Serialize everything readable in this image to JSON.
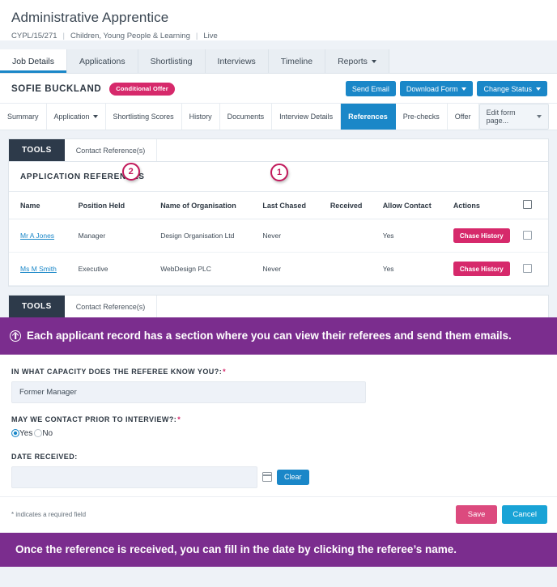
{
  "job": {
    "title": "Administrative Apprentice",
    "reference": "CYPL/15/271",
    "department": "Children, Young People & Learning",
    "status": "Live",
    "tabs": [
      {
        "label": "Job Details",
        "active": true,
        "caret": false
      },
      {
        "label": "Applications",
        "active": false,
        "caret": false
      },
      {
        "label": "Shortlisting",
        "active": false,
        "caret": false
      },
      {
        "label": "Interviews",
        "active": false,
        "caret": false
      },
      {
        "label": "Timeline",
        "active": false,
        "caret": false
      },
      {
        "label": "Reports",
        "active": false,
        "caret": true
      }
    ]
  },
  "candidate": {
    "name": "SOFIE BUCKLAND",
    "badge": "Conditional Offer",
    "actions": [
      {
        "label": "Send Email",
        "caret": false
      },
      {
        "label": "Download Form",
        "caret": true
      },
      {
        "label": "Change Status",
        "caret": true
      }
    ],
    "sub_tabs": [
      {
        "label": "Summary",
        "active": false,
        "caret": false
      },
      {
        "label": "Application",
        "active": false,
        "caret": true
      },
      {
        "label": "Shortlisting Scores",
        "active": false,
        "caret": false
      },
      {
        "label": "History",
        "active": false,
        "caret": false
      },
      {
        "label": "Documents",
        "active": false,
        "caret": false
      },
      {
        "label": "Interview Details",
        "active": false,
        "caret": false
      },
      {
        "label": "References",
        "active": true,
        "caret": false
      },
      {
        "label": "Pre-checks",
        "active": false,
        "caret": false
      },
      {
        "label": "Offer",
        "active": false,
        "caret": false
      }
    ],
    "edit_form_page": "Edit form page..."
  },
  "tools": {
    "label": "TOOLS",
    "link": "Contact Reference(s)"
  },
  "references": {
    "section_title": "APPLICATION REFERENCES",
    "columns": [
      "Name",
      "Position Held",
      "Name of Organisation",
      "Last Chased",
      "Received",
      "Allow Contact",
      "Actions"
    ],
    "rows": [
      {
        "name": "Mr A Jones",
        "position": "Manager",
        "organisation": "Design Organisation Ltd",
        "last_chased": "Never",
        "received": "",
        "allow_contact": "Yes",
        "action": "Chase History"
      },
      {
        "name": "Ms M Smith",
        "position": "Executive",
        "organisation": "WebDesign PLC",
        "last_chased": "Never",
        "received": "",
        "allow_contact": "Yes",
        "action": "Chase History"
      }
    ]
  },
  "annotations": {
    "one": "1",
    "two": "2"
  },
  "callout_top": "Each applicant record has a section where you can view their referees and send them emails.",
  "callout_bottom": "Once the reference is received, you can fill in the date by clicking the referee’s name.",
  "form": {
    "capacity_label": "IN WHAT CAPACITY DOES THE REFEREE KNOW YOU?:",
    "capacity_value": "Former Manager",
    "contact_label": "MAY WE CONTACT PRIOR TO INTERVIEW?:",
    "contact_yes": "Yes",
    "contact_no": "No",
    "contact_selected": "Yes",
    "date_label": "DATE RECEIVED:",
    "date_value": "",
    "clear_label": "Clear",
    "required_note": "* indicates a required field",
    "save_label": "Save",
    "cancel_label": "Cancel",
    "required_marker": "*"
  },
  "colors": {
    "accent_blue": "#1a87c8",
    "accent_pink": "#d6296b",
    "purple": "#7b2d8e",
    "navy": "#2d3a4a"
  }
}
